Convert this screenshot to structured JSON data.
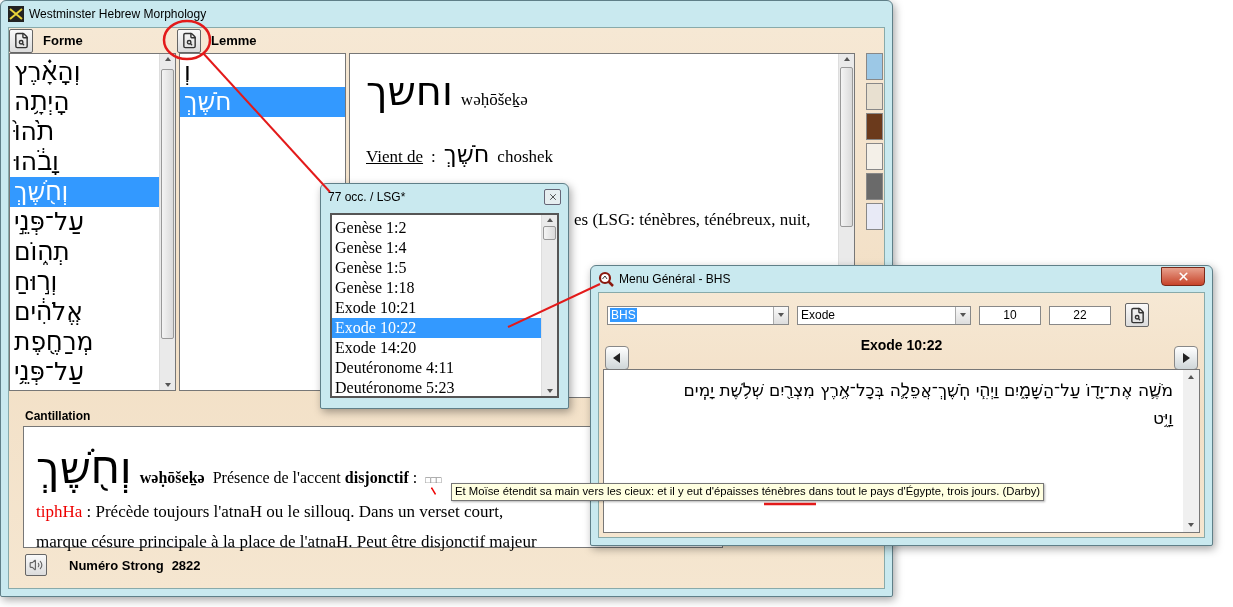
{
  "main_window": {
    "title": "Westminster Hebrew Morphology",
    "forme": {
      "label": "Forme",
      "items": [
        {
          "text": "וְהָאָ֗רֶץ",
          "selected": false
        },
        {
          "text": "הָיְתָ֥ה",
          "selected": false
        },
        {
          "text": "תֹ֙הוּ֙",
          "selected": false
        },
        {
          "text": "וָבֹ֔הוּ",
          "selected": false
        },
        {
          "text": "וְחֹ֖שֶׁךְ",
          "selected": true
        },
        {
          "text": "עַל־פְּנֵ֣י",
          "selected": false
        },
        {
          "text": "תְה֑וֹם",
          "selected": false
        },
        {
          "text": "וְר֣וּחַ",
          "selected": false
        },
        {
          "text": "אֱלֹהִ֔ים",
          "selected": false
        },
        {
          "text": "מְרַחֶ֖פֶת",
          "selected": false
        },
        {
          "text": "עַל־פְּנֵ֥י",
          "selected": false
        }
      ]
    },
    "lemme": {
      "label": "Lemme",
      "items": [
        {
          "text": "וְ",
          "selected": false
        },
        {
          "text": "חֹשֶׁךְ",
          "selected": true
        }
      ]
    },
    "detail": {
      "word": "וחשך",
      "transliteration": "wəḥōšeḵə",
      "origin_link": "Vient de",
      "separator": ":",
      "origin_word": "חֹשֶׁךְ",
      "origin_translit": "choshek",
      "definition_fragment": "es (LSG: ténèbres, ténébreux, nuit,"
    },
    "cantillation": {
      "label": "Cantillation",
      "word": "וְחֹ֖שֶׁךְ",
      "transliteration": "wəḥōšeḵə",
      "presence": "Présence de l'accent **disjonctif** :",
      "missing_glyphs": "□□□",
      "accent_name": "tiphHa",
      "description_lines": [
        " : Précède toujours l'atnaH ou le sillouq. Dans un verset court,",
        "marque césure principale à la place de l'atnaH. Peut être disjonctif majeur"
      ]
    },
    "strong": {
      "label": "Numéro Strong",
      "number": "2822"
    }
  },
  "occurrences_popup": {
    "title": "77 occ. / LSG*",
    "items": [
      {
        "text": "Genèse 1:2",
        "selected": false
      },
      {
        "text": "Genèse 1:4",
        "selected": false
      },
      {
        "text": "Genèse 1:5",
        "selected": false
      },
      {
        "text": "Genèse 1:18",
        "selected": false
      },
      {
        "text": "Exode 10:21",
        "selected": false
      },
      {
        "text": "Exode 10:22",
        "selected": true
      },
      {
        "text": "Exode 14:20",
        "selected": false
      },
      {
        "text": "Deutéronome 4:11",
        "selected": false
      },
      {
        "text": "Deutéronome 5:23",
        "selected": false
      }
    ]
  },
  "menu_window": {
    "title": "Menu Général - BHS",
    "version": "BHS",
    "book": "Exode",
    "chapter": "10",
    "verse": "22",
    "reference": "Exode 10:22",
    "verse_lines": [
      "מֹשֶׁ֛ה אֶת־יָד֖וֹ עַל־הַשָּׁמָ֑יִם וַיְהִ֧י חֹֽשֶׁךְ־אֲפֵלָ֛ה בְּכָל־אֶ֥רֶץ מִצְרַ֖יִם שְׁלֹ֥שֶׁת יָמִֽים",
      "וַיֵּ֥ט"
    ]
  },
  "tooltip": {
    "text": "Et Moïse étendit sa main vers les cieux: et il y eut d'épaisses ténèbres dans tout le pays d'Égypte, trois jours. (Darby)"
  }
}
